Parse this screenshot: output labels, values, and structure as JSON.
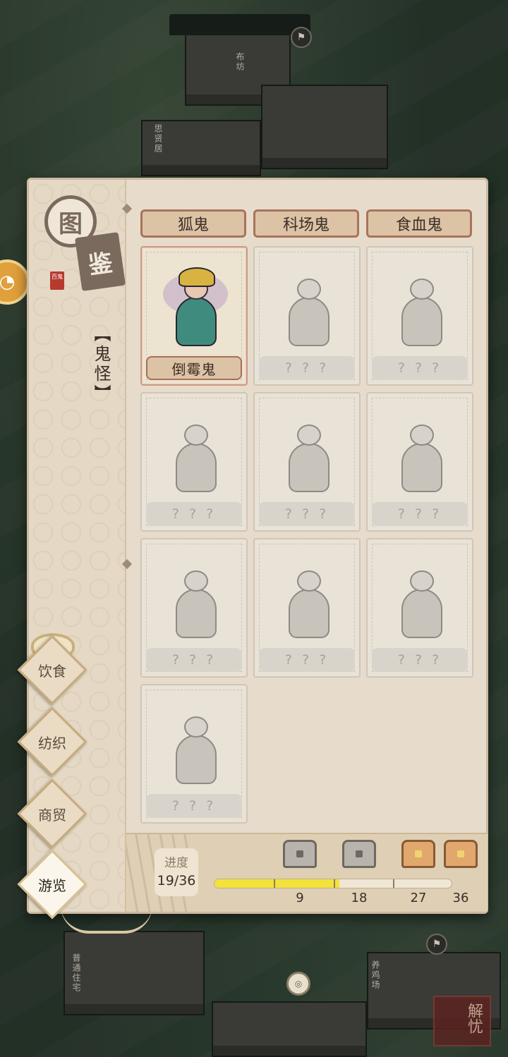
{
  "map": {
    "labels": [
      "布坊",
      "思贤居",
      "普通住宅",
      "养鸡场"
    ],
    "corner_stamp": "解忧"
  },
  "book": {
    "emblem": "图",
    "emblem_tag": "鉴",
    "seal": "百鬼",
    "category": "【鬼怪】"
  },
  "nav": {
    "items": [
      {
        "label": "饮食",
        "active": false
      },
      {
        "label": "纺织",
        "active": false
      },
      {
        "label": "商贸",
        "active": false
      },
      {
        "label": "游览",
        "active": true
      }
    ]
  },
  "top_row_names": [
    "狐鬼",
    "科场鬼",
    "食血鬼"
  ],
  "cards": [
    {
      "name": "倒霉鬼",
      "unlocked": true
    },
    {
      "name": "? ? ?",
      "unlocked": false
    },
    {
      "name": "? ? ?",
      "unlocked": false
    },
    {
      "name": "? ? ?",
      "unlocked": false
    },
    {
      "name": "? ? ?",
      "unlocked": false
    },
    {
      "name": "? ? ?",
      "unlocked": false
    },
    {
      "name": "? ? ?",
      "unlocked": false
    },
    {
      "name": "? ? ?",
      "unlocked": false
    },
    {
      "name": "? ? ?",
      "unlocked": false
    },
    {
      "name": "? ? ?",
      "unlocked": false
    }
  ],
  "progress": {
    "label": "进度",
    "value": "19/36",
    "current": 19,
    "total": 36,
    "milestones": [
      {
        "value": "9",
        "chest": "silver"
      },
      {
        "value": "18",
        "chest": "silver"
      },
      {
        "value": "27",
        "chest": "gold"
      },
      {
        "value": "36",
        "chest": "gold"
      }
    ]
  }
}
